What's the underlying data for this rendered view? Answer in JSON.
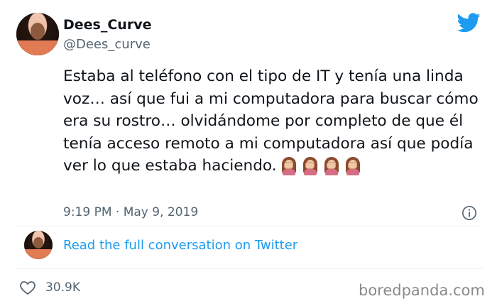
{
  "author": {
    "display_name": "Dees_Curve",
    "handle": "@Dees_curve"
  },
  "tweet": {
    "text": "Estaba al teléfono con el tipo de IT y tenía una linda voz… así que fui a mi computadora para buscar cómo era su rostro… olvidándome por completo de que él tenía acceso remoto a mi computadora así que podía ver lo que estaba haciendo.",
    "emoji": "woman-facepalming-icon",
    "emoji_count": 4,
    "timestamp": "9:19 PM · May 9, 2019"
  },
  "conversation_link": "Read the full conversation on Twitter",
  "likes": "30.9K",
  "watermark": "boredpanda.com",
  "colors": {
    "link": "#1d9bf0",
    "twitter_blue": "#1d9bf0",
    "secondary_text": "#536471"
  }
}
